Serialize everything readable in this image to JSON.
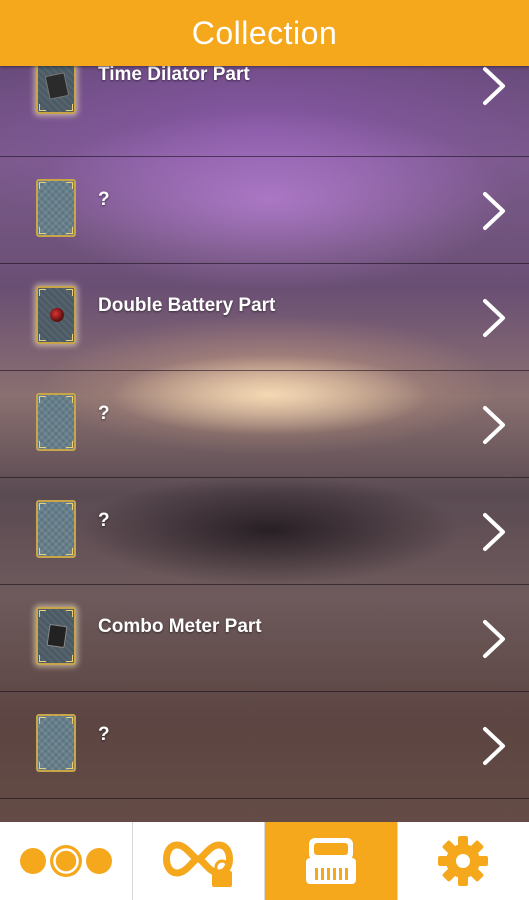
{
  "header": {
    "title": "Collection"
  },
  "colors": {
    "accent": "#f5a81c",
    "text": "#ffffff",
    "card_border": "#c9a54a"
  },
  "collection": {
    "items": [
      {
        "label": "Time Dilator Part",
        "unlocked": true,
        "icon": "time-dilator-part-icon"
      },
      {
        "label": "?",
        "unlocked": false,
        "icon": "card-back-icon"
      },
      {
        "label": "Double Battery Part",
        "unlocked": true,
        "icon": "double-battery-part-icon"
      },
      {
        "label": "?",
        "unlocked": false,
        "icon": "card-back-icon"
      },
      {
        "label": "?",
        "unlocked": false,
        "icon": "card-back-icon"
      },
      {
        "label": "Combo Meter Part",
        "unlocked": true,
        "icon": "combo-meter-part-icon"
      },
      {
        "label": "?",
        "unlocked": false,
        "icon": "card-back-icon"
      }
    ]
  },
  "tabbar": {
    "tabs": [
      {
        "id": "levels",
        "icon": "three-circles-icon",
        "active": false
      },
      {
        "id": "infinite",
        "icon": "infinity-lock-icon",
        "active": false
      },
      {
        "id": "collection",
        "icon": "chest-icon",
        "active": true
      },
      {
        "id": "settings",
        "icon": "gear-icon",
        "active": false
      }
    ]
  }
}
